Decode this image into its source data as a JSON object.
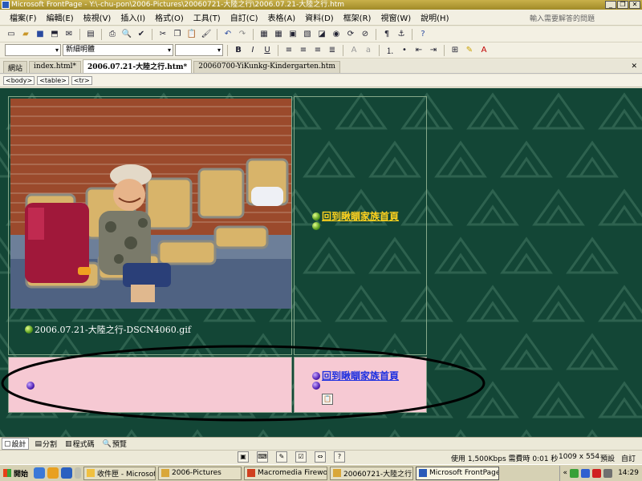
{
  "window": {
    "title": "Microsoft FrontPage - Y:\\-chu-pon\\2006-Pictures\\20060721-大陸之行\\2006.07.21-大陸之行.htm",
    "min_label": "_",
    "max_label": "❐",
    "close_label": "✕"
  },
  "menu": {
    "items": [
      "檔案(F)",
      "編輯(E)",
      "檢視(V)",
      "插入(I)",
      "格式(O)",
      "工具(T)",
      "自訂(C)",
      "表格(A)",
      "資料(D)",
      "框架(R)",
      "視窗(W)",
      "說明(H)"
    ],
    "help_placeholder": "輸入需要解答的問題"
  },
  "format_toolbar": {
    "style_value": "",
    "font_value": "新細明體",
    "size_value": "",
    "bold": "B",
    "italic": "I",
    "underline": "U"
  },
  "tabs": {
    "items": [
      "網站",
      "index.html*",
      "2006.07.21-大陸之行.htm*",
      "20060700-YiKunkg-Kindergarten.htm"
    ],
    "active_index": 2,
    "close": "✕"
  },
  "tag_selector": [
    "<body>",
    "<table>",
    "<tr>"
  ],
  "content": {
    "caption": "2006.07.21-大陸之行-DSCN4060.gif",
    "nav_link_top": "回到瞅瞓家族首頁",
    "nav_link_bottom": "回到瞅瞓家族首頁"
  },
  "view_tabs": [
    "設計",
    "分割",
    "程式碼",
    "預覽"
  ],
  "status": {
    "speed": "使用 1,500Kbps 需費時 0:01 秒",
    "dimensions": "1009 x 554",
    "mode1": "預設",
    "mode2": "自訂"
  },
  "taskbar": {
    "start": "開始",
    "tasks": [
      "收件匣 - Microsoft ...",
      "2006-Pictures",
      "Macromedia Firewor...",
      "20060721-大陸之行",
      "Microsoft FrontPage ..."
    ],
    "active_task": 4,
    "clock": "14:29"
  },
  "colors": {
    "canvas_bg": "#134636",
    "pink_cell": "#f6c9d3",
    "link_gold": "#ffd21e",
    "link_blue": "#1d2fe0"
  }
}
